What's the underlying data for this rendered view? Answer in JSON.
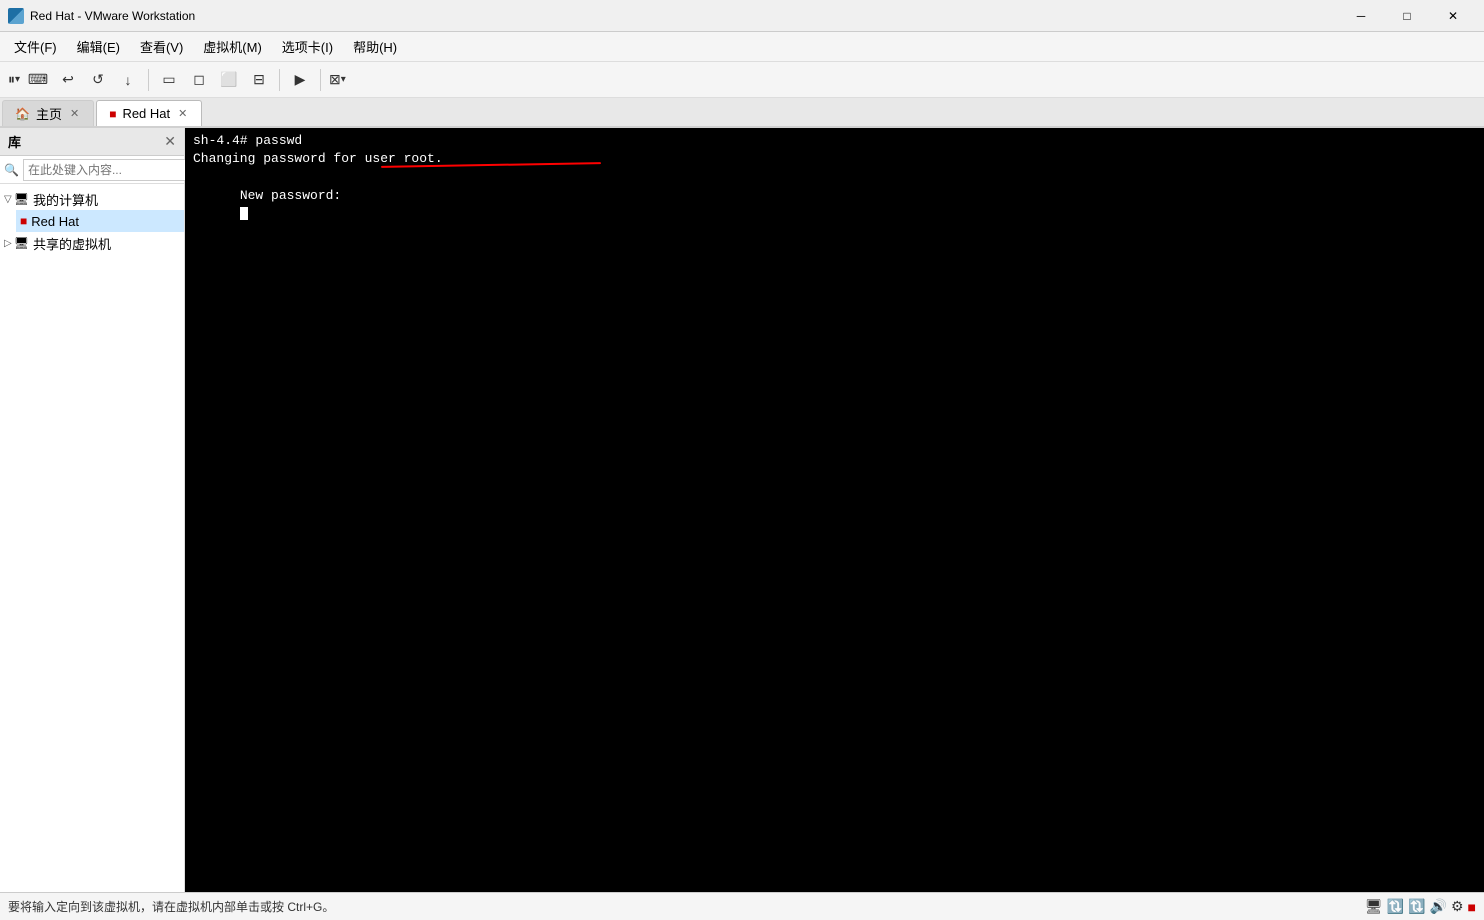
{
  "titleBar": {
    "icon": "vmware-logo",
    "title": "Red Hat - VMware Workstation",
    "minBtn": "─",
    "maxBtn": "□",
    "closeBtn": "✕"
  },
  "menuBar": {
    "items": [
      {
        "label": "文件(F)"
      },
      {
        "label": "编辑(E)"
      },
      {
        "label": "查看(V)"
      },
      {
        "label": "虚拟机(M)"
      },
      {
        "label": "选项卡(I)"
      },
      {
        "label": "帮助(H)"
      }
    ]
  },
  "toolbar": {
    "buttons": [
      {
        "name": "pause-button",
        "icon": "⏸",
        "hasDropdown": true
      },
      {
        "name": "send-ctrl-alt-del",
        "icon": "⌨"
      },
      {
        "name": "revert",
        "icon": "↩"
      },
      {
        "name": "suspend",
        "icon": "⏯"
      },
      {
        "name": "power-off",
        "icon": "⏹"
      },
      {
        "name": "separator1",
        "type": "separator"
      },
      {
        "name": "fullscreen",
        "icon": "▭"
      },
      {
        "name": "unity",
        "icon": "◻"
      },
      {
        "name": "fit-vm",
        "icon": "⬜"
      },
      {
        "name": "autofit",
        "icon": "⊟"
      },
      {
        "name": "separator2",
        "type": "separator"
      },
      {
        "name": "console",
        "icon": "▶"
      },
      {
        "name": "separator3",
        "type": "separator"
      },
      {
        "name": "view-toggle",
        "icon": "⊠",
        "hasDropdown": true
      }
    ]
  },
  "tabs": {
    "home": {
      "label": "主页",
      "icon": "🏠",
      "active": false
    },
    "redhat": {
      "label": "Red Hat",
      "icon": "🖥",
      "active": true,
      "closeable": true
    }
  },
  "sidebar": {
    "title": "库",
    "searchPlaceholder": "在此处键入内容...",
    "tree": [
      {
        "label": "我的计算机",
        "icon": "💻",
        "expanded": true,
        "level": 1,
        "children": [
          {
            "label": "Red Hat",
            "icon": "🟥",
            "level": 2,
            "selected": true
          }
        ]
      },
      {
        "label": "共享的虚拟机",
        "icon": "💻",
        "expanded": false,
        "level": 1
      }
    ]
  },
  "terminal": {
    "lines": [
      "sh-4.4# passwd",
      "Changing password for user root.",
      "New password:"
    ]
  },
  "statusBar": {
    "message": "要将输入定向到该虚拟机，请在虚拟机内部单击或按 Ctrl+G。",
    "icons": [
      "🖥",
      "🔃",
      "🔃",
      "🔊",
      "⚙",
      "🟥"
    ]
  }
}
